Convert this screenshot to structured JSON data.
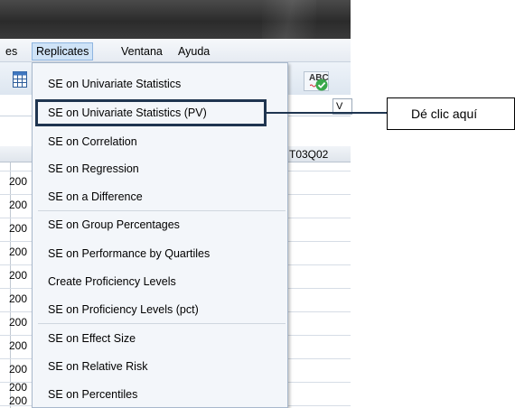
{
  "menubar": {
    "items": [
      {
        "label": "es"
      },
      {
        "label": "Replicates"
      },
      {
        "label": "Ventana"
      },
      {
        "label": "Ayuda"
      }
    ]
  },
  "toolbar": {
    "spell_label": "ABC",
    "spell_icon": "spellcheck-icon"
  },
  "grid": {
    "variable_box": "V",
    "column_header": "T03Q02",
    "row_labels": [
      "200",
      "200",
      "200",
      "200",
      "200",
      "200",
      "200",
      "200",
      "200",
      "200",
      "200"
    ]
  },
  "dropdown": {
    "items": [
      {
        "label": "SE on Univariate Statistics"
      },
      {
        "label": "SE on Univariate Statistics (PV)"
      },
      {
        "label": "SE on Correlation"
      },
      {
        "label": "SE on Regression"
      },
      {
        "label": "SE on a Difference"
      },
      {
        "label": "SE on Group Percentages"
      },
      {
        "label": "SE on Performance by Quartiles"
      },
      {
        "label": "Create Proficiency Levels"
      },
      {
        "label": "SE on Proficiency Levels (pct)"
      },
      {
        "label": "SE on Effect Size"
      },
      {
        "label": "SE on Relative Risk"
      },
      {
        "label": "SE on Percentiles"
      }
    ]
  },
  "callout": {
    "text": "Dé clic aquí"
  },
  "colors": {
    "highlight_border": "#1f3550",
    "menu_active": "#cfe3f7",
    "check_green": "#3aa84a"
  }
}
